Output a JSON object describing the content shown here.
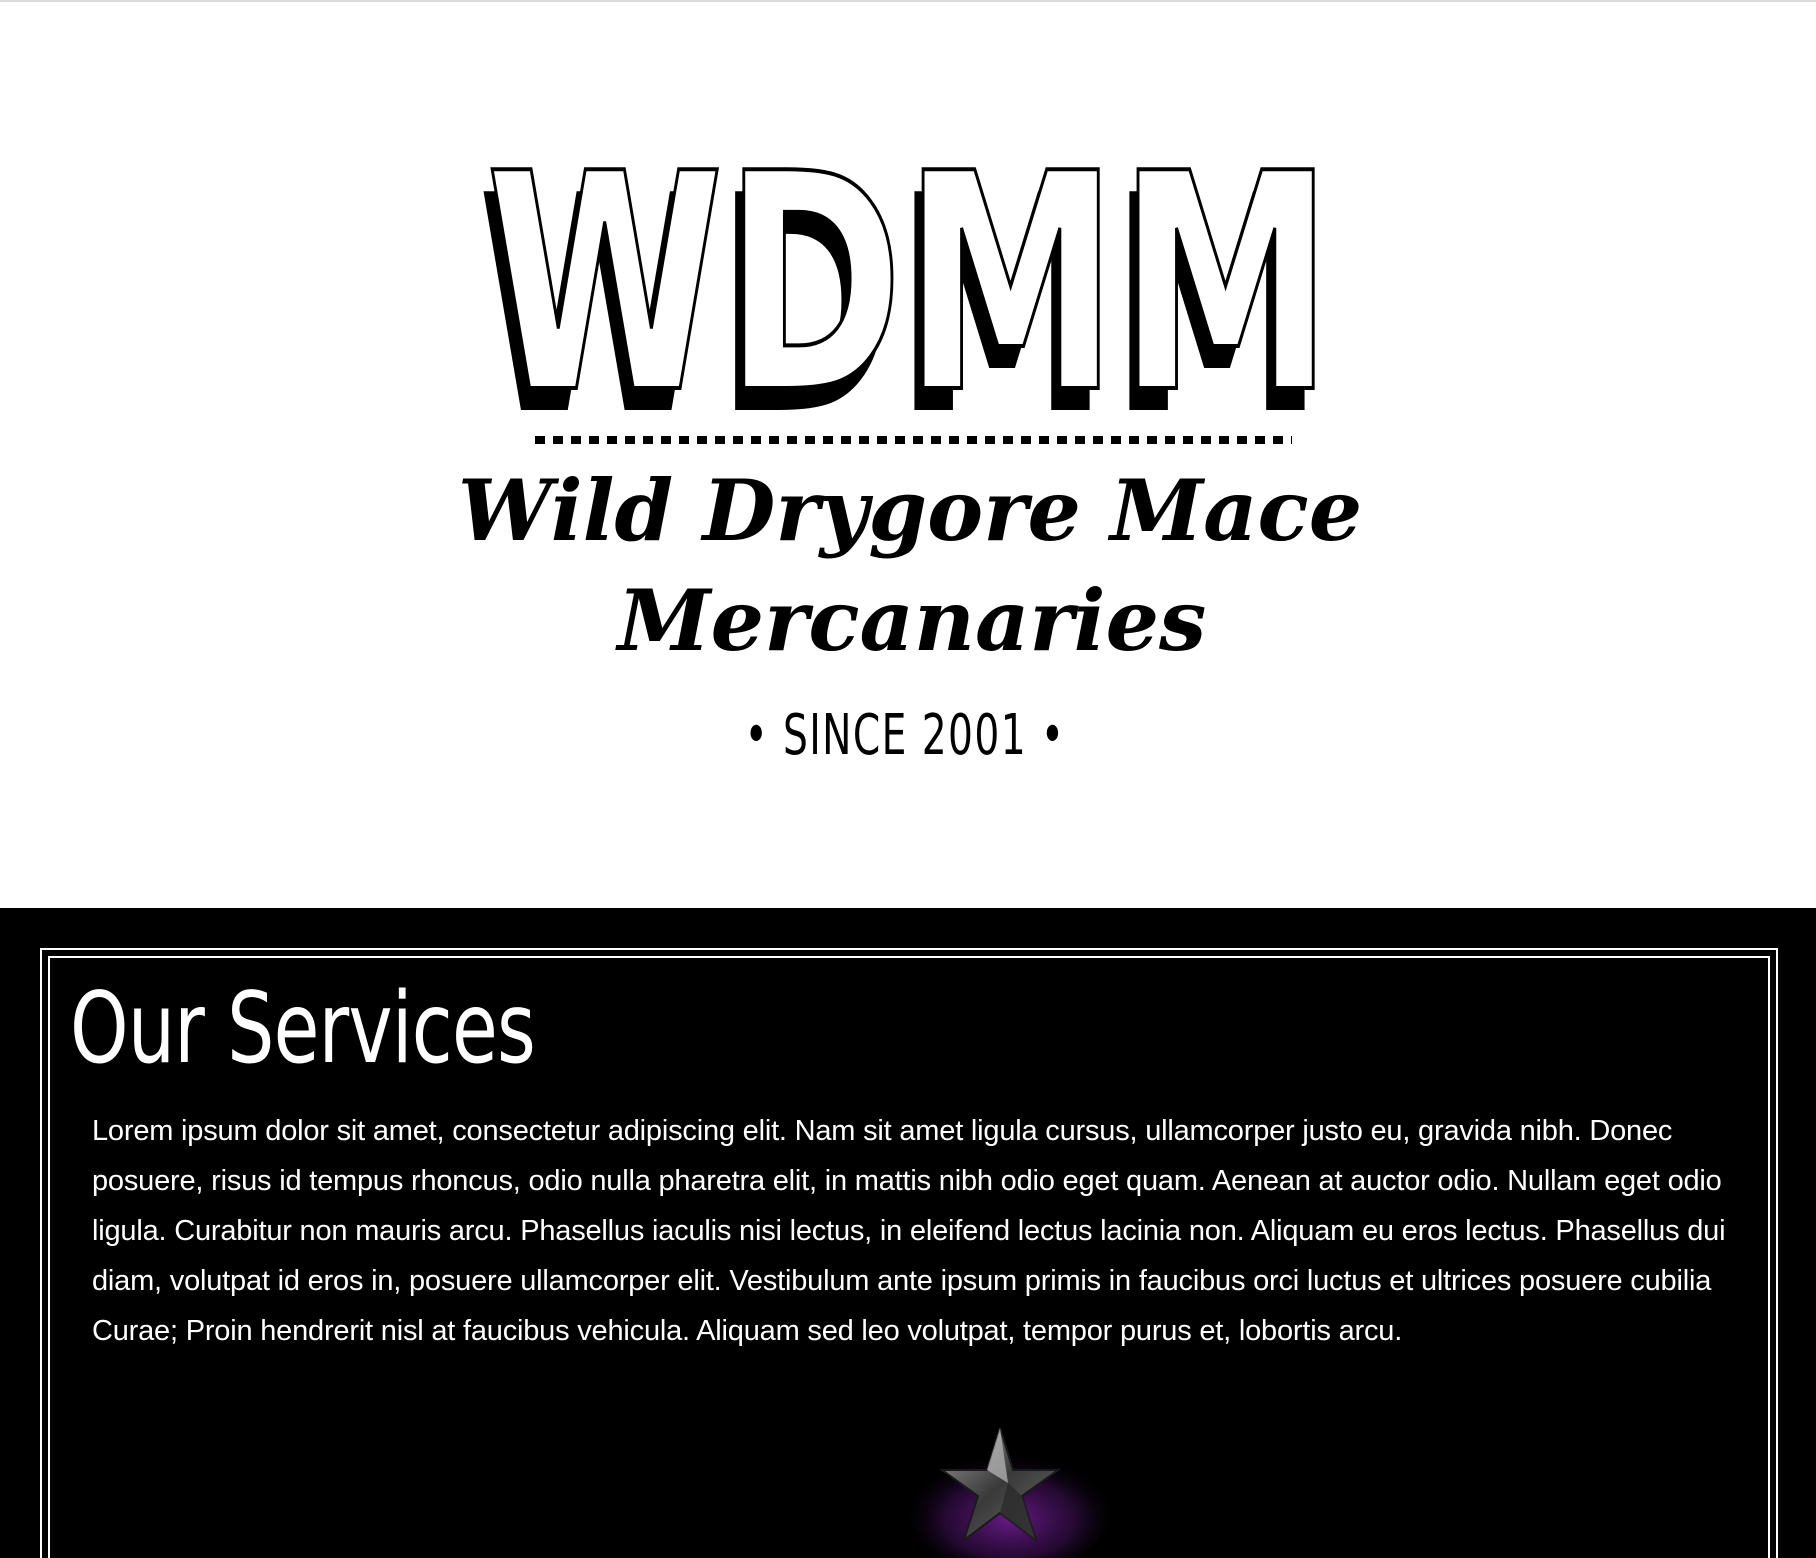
{
  "logo": {
    "monogram": "WDMM",
    "name_line_1": "Wild Drygore Mace",
    "name_line_2": "Mercanaries",
    "since": "• SINCE 2001 •"
  },
  "services": {
    "title": "Our Services",
    "body": "Lorem ipsum dolor sit amet, consectetur adipiscing elit. Nam sit amet ligula cursus, ullamcorper justo eu, gravida nibh. Donec posuere, risus id tempus rhoncus, odio nulla pharetra elit, in mattis nibh odio eget quam. Aenean at auctor odio. Nullam eget odio ligula. Curabitur non mauris arcu. Phasellus iaculis nisi lectus, in eleifend lectus lacinia non. Aliquam eu eros lectus. Phasellus dui diam, volutpat id eros in, posuere ullamcorper elit. Vestibulum ante ipsum primis in faucibus orci luctus et ultrices posuere cubilia Curae; Proin hendrerit nisl at faucibus vehicula. Aliquam sed leo volutpat, tempor purus et, lobortis arcu.",
    "emblem_icon": "purple-star-emblem-icon"
  },
  "colors": {
    "hero_background": "#ffffff",
    "services_background": "#000000",
    "text_on_dark": "#ffffff",
    "emblem_accent": "#7a1fa0"
  }
}
